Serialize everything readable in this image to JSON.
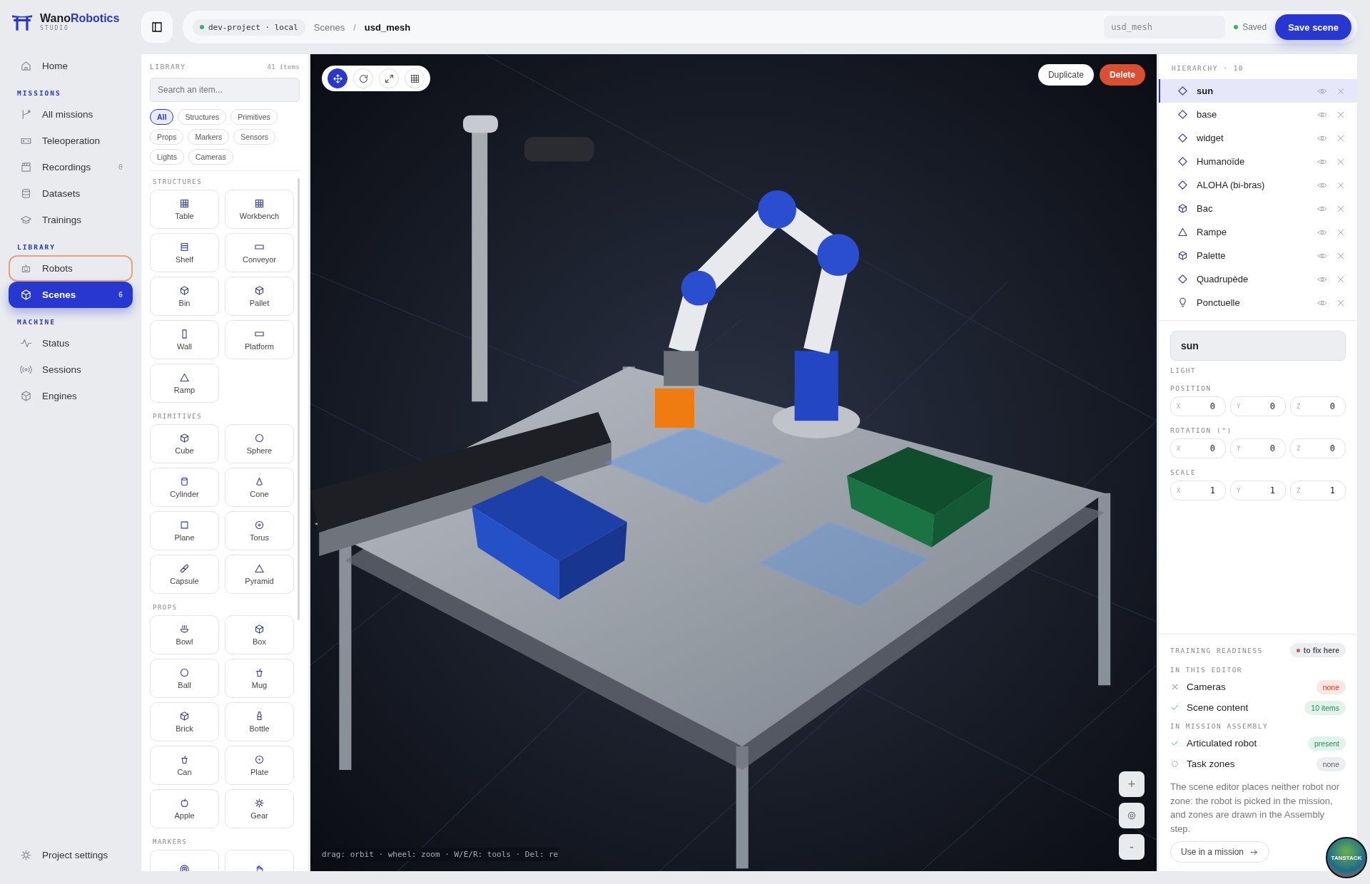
{
  "brand": {
    "name_parts": [
      "Wano",
      "Robotics"
    ],
    "subtitle": "STUDIO"
  },
  "sidebar": {
    "sections": [
      {
        "items": [
          {
            "label": "Home",
            "selected": false,
            "focused": false
          }
        ]
      },
      {
        "title": "MISSIONS",
        "items": [
          {
            "label": "All missions",
            "selected": false,
            "focused": false
          },
          {
            "label": "Teleoperation",
            "selected": false,
            "focused": false
          },
          {
            "label": "Recordings",
            "count": "0",
            "selected": false,
            "focused": false
          },
          {
            "label": "Datasets",
            "selected": false,
            "focused": false
          },
          {
            "label": "Trainings",
            "selected": false,
            "focused": false
          }
        ]
      },
      {
        "title": "LIBRARY",
        "items": [
          {
            "label": "Robots",
            "selected": false,
            "focused": true
          },
          {
            "label": "Scenes",
            "count": "6",
            "selected": true,
            "focused": false
          }
        ]
      },
      {
        "title": "MACHINE",
        "items": [
          {
            "label": "Status",
            "selected": false,
            "focused": false
          },
          {
            "label": "Sessions",
            "selected": false,
            "focused": false
          },
          {
            "label": "Engines",
            "selected": false,
            "focused": false
          }
        ]
      }
    ],
    "footer": {
      "label": "Project settings"
    }
  },
  "topbar": {
    "project": "dev-project · local",
    "breadcrumb": [
      "Scenes",
      "usd_mesh"
    ],
    "breadcrumb_separator": "/",
    "name_field": {
      "placeholder": "usd_mesh"
    },
    "status": "Saved",
    "save_button": "Save scene"
  },
  "library": {
    "title": "LIBRARY",
    "count": "41 items",
    "search": {
      "placeholder": "Search an item..."
    },
    "filters": [
      {
        "label": "All",
        "selected": true
      },
      {
        "label": "Structures",
        "selected": false
      },
      {
        "label": "Primitives",
        "selected": false
      },
      {
        "label": "Props",
        "selected": false
      },
      {
        "label": "Markers",
        "selected": false
      },
      {
        "label": "Sensors",
        "selected": false
      },
      {
        "label": "Lights",
        "selected": false
      },
      {
        "label": "Cameras",
        "selected": false
      }
    ],
    "groups": [
      {
        "title": "STRUCTURES",
        "items": [
          {
            "label": "Table",
            "kind": "grid"
          },
          {
            "label": "Workbench",
            "kind": "grid"
          },
          {
            "label": "Shelf",
            "kind": "rows"
          },
          {
            "label": "Conveyor",
            "kind": "wide"
          },
          {
            "label": "Bin",
            "kind": "cube"
          },
          {
            "label": "Pallet",
            "kind": "cube"
          },
          {
            "label": "Wall",
            "kind": "tall"
          },
          {
            "label": "Platform",
            "kind": "wide"
          },
          {
            "label": "Ramp",
            "kind": "triangle"
          }
        ]
      },
      {
        "title": "PRIMITIVES",
        "items": [
          {
            "label": "Cube",
            "kind": "cube"
          },
          {
            "label": "Sphere",
            "kind": "circle"
          },
          {
            "label": "Cylinder",
            "kind": "cylinder"
          },
          {
            "label": "Cone",
            "kind": "cone"
          },
          {
            "label": "Plane",
            "kind": "square"
          },
          {
            "label": "Torus",
            "kind": "torus"
          },
          {
            "label": "Capsule",
            "kind": "capsule"
          },
          {
            "label": "Pyramid",
            "kind": "triangle"
          }
        ]
      },
      {
        "title": "PROPS",
        "items": [
          {
            "label": "Bowl",
            "kind": "bowl"
          },
          {
            "label": "Box",
            "kind": "cube"
          },
          {
            "label": "Ball",
            "kind": "circle"
          },
          {
            "label": "Mug",
            "kind": "mug"
          },
          {
            "label": "Brick",
            "kind": "cube"
          },
          {
            "label": "Bottle",
            "kind": "bottle"
          },
          {
            "label": "Can",
            "kind": "mug"
          },
          {
            "label": "Plate",
            "kind": "plate"
          },
          {
            "label": "Apple",
            "kind": "apple"
          },
          {
            "label": "Gear",
            "kind": "gear"
          }
        ]
      },
      {
        "title": "MARKERS",
        "items": [
          {
            "kind": "target"
          },
          {
            "kind": "hand"
          }
        ]
      }
    ]
  },
  "viewport": {
    "tools": [
      {
        "selected": true
      },
      {
        "selected": false
      },
      {
        "selected": false
      },
      {
        "selected": false
      }
    ],
    "actions": [
      {
        "label": "Duplicate",
        "kind": "secondary"
      },
      {
        "label": "Delete",
        "kind": "danger"
      }
    ],
    "zoom": [
      {
        "kind": "text",
        "label": "+"
      },
      {
        "kind": "icon"
      },
      {
        "kind": "text",
        "label": "-"
      }
    ],
    "hint": "drag: orbit · wheel: zoom · W/E/R: tools · Del: re"
  },
  "hierarchy": {
    "title": "HIERARCHY · 10",
    "items": [
      {
        "name": "sun",
        "kind": "diamond",
        "selected": true
      },
      {
        "name": "base",
        "kind": "diamond",
        "selected": false
      },
      {
        "name": "widget",
        "kind": "diamond",
        "selected": false
      },
      {
        "name": "Humanoïde",
        "kind": "diamond",
        "selected": false
      },
      {
        "name": "ALOHA (bi-bras)",
        "kind": "diamond",
        "selected": false
      },
      {
        "name": "Bac",
        "kind": "cube",
        "selected": false
      },
      {
        "name": "Rampe",
        "kind": "triangle",
        "selected": false
      },
      {
        "name": "Palette",
        "kind": "cube",
        "selected": false
      },
      {
        "name": "Quadrupède",
        "kind": "diamond",
        "selected": false
      },
      {
        "name": "Ponctuelle",
        "kind": "bulb",
        "selected": false
      }
    ]
  },
  "properties": {
    "name": "sun",
    "type": "LIGHT",
    "groups": [
      {
        "title": "POSITION",
        "fields": [
          {
            "axis": "X",
            "value": "0"
          },
          {
            "axis": "Y",
            "value": "0"
          },
          {
            "axis": "Z",
            "value": "0"
          }
        ]
      },
      {
        "title": "ROTATION (°)",
        "fields": [
          {
            "axis": "X",
            "value": "0"
          },
          {
            "axis": "Y",
            "value": "0"
          },
          {
            "axis": "Z",
            "value": "0"
          }
        ]
      },
      {
        "title": "SCALE",
        "fields": [
          {
            "axis": "X",
            "value": "1"
          },
          {
            "axis": "Y",
            "value": "1"
          },
          {
            "axis": "Z",
            "value": "1"
          }
        ]
      }
    ]
  },
  "readiness": {
    "title": "TRAINING READINESS",
    "badge": "to fix here",
    "groups": [
      {
        "title": "IN THIS EDITOR",
        "items": [
          {
            "label": "Cameras",
            "kind": "fail",
            "badge": "none"
          },
          {
            "label": "Scene content",
            "kind": "ok",
            "badge": "10 items"
          }
        ]
      },
      {
        "title": "IN MISSION ASSEMBLY",
        "items": [
          {
            "label": "Articulated robot",
            "kind": "ok",
            "badge": "present"
          },
          {
            "label": "Task zones",
            "kind": "pending",
            "badge": "none"
          }
        ]
      }
    ],
    "note": "The scene editor places neither robot nor zone: the robot is picked in the mission, and zones are drawn in the Assembly step.",
    "button": "Use in a mission"
  },
  "devtools_badge": "TANSTACK"
}
